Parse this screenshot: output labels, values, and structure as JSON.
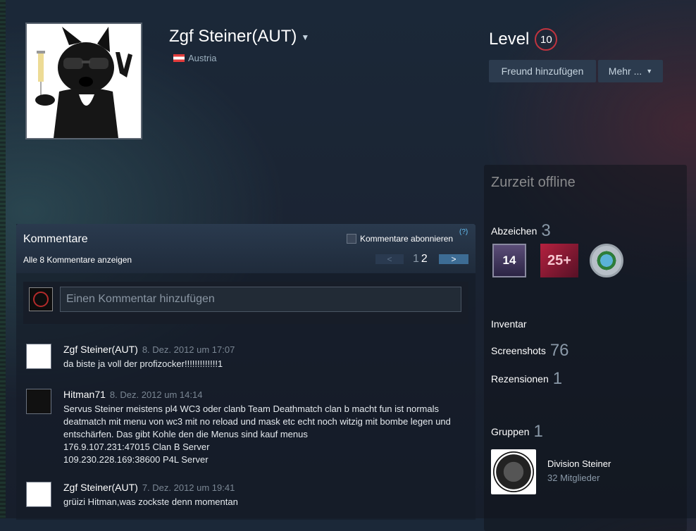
{
  "profile": {
    "persona_name": "Zgf Steiner(AUT)",
    "country": "Austria",
    "level_label": "Level",
    "level_value": "10"
  },
  "actions": {
    "add_friend": "Freund hinzufügen",
    "more": "Mehr ..."
  },
  "right": {
    "status": "Zurzeit offline",
    "badges_label": "Abzeichen",
    "badges_count": "3",
    "badges": [
      {
        "icon": "year-14-badge-icon",
        "text": "14"
      },
      {
        "icon": "25-plus-badge-icon",
        "text": "25+"
      },
      {
        "icon": "globe-badge-icon",
        "text": ""
      }
    ],
    "inventory_label": "Inventar",
    "screenshots_label": "Screenshots",
    "screenshots_count": "76",
    "reviews_label": "Rezensionen",
    "reviews_count": "1",
    "groups_label": "Gruppen",
    "groups_count": "1",
    "group": {
      "name": "Division Steiner",
      "members": "32 Mitglieder"
    }
  },
  "comments": {
    "title": "Kommentare",
    "subscribe_label": "Kommentare abonnieren",
    "help": "(?)",
    "show_all": "Alle 8 Kommentare anzeigen",
    "pager": {
      "prev": "<",
      "page1": "1",
      "page2": "2",
      "next": ">"
    },
    "input_placeholder": "Einen Kommentar hinzufügen",
    "items": [
      {
        "author": "Zgf Steiner(AUT)",
        "time": "8. Dez. 2012 um 17:07",
        "text": "da biste ja voll der profizocker!!!!!!!!!!!!!1"
      },
      {
        "author": "Hitman71",
        "time": "8. Dez. 2012 um 14:14",
        "text": "Servus Steiner meistens pl4 WC3 oder clanb Team Deathmatch clan b macht fun ist normals deatmatch mit menu von wc3 mit no reload und mask etc echt noch witzig mit bombe legen und entschärfen. Das gibt Kohle den die Menus sind kauf menus\n176.9.107.231:47015 Clan B Server\n109.230.228.169:38600 P4L Server"
      },
      {
        "author": "Zgf Steiner(AUT)",
        "time": "7. Dez. 2012 um 19:41",
        "text": "grüizi Hitman,was zockste denn momentan"
      }
    ]
  }
}
